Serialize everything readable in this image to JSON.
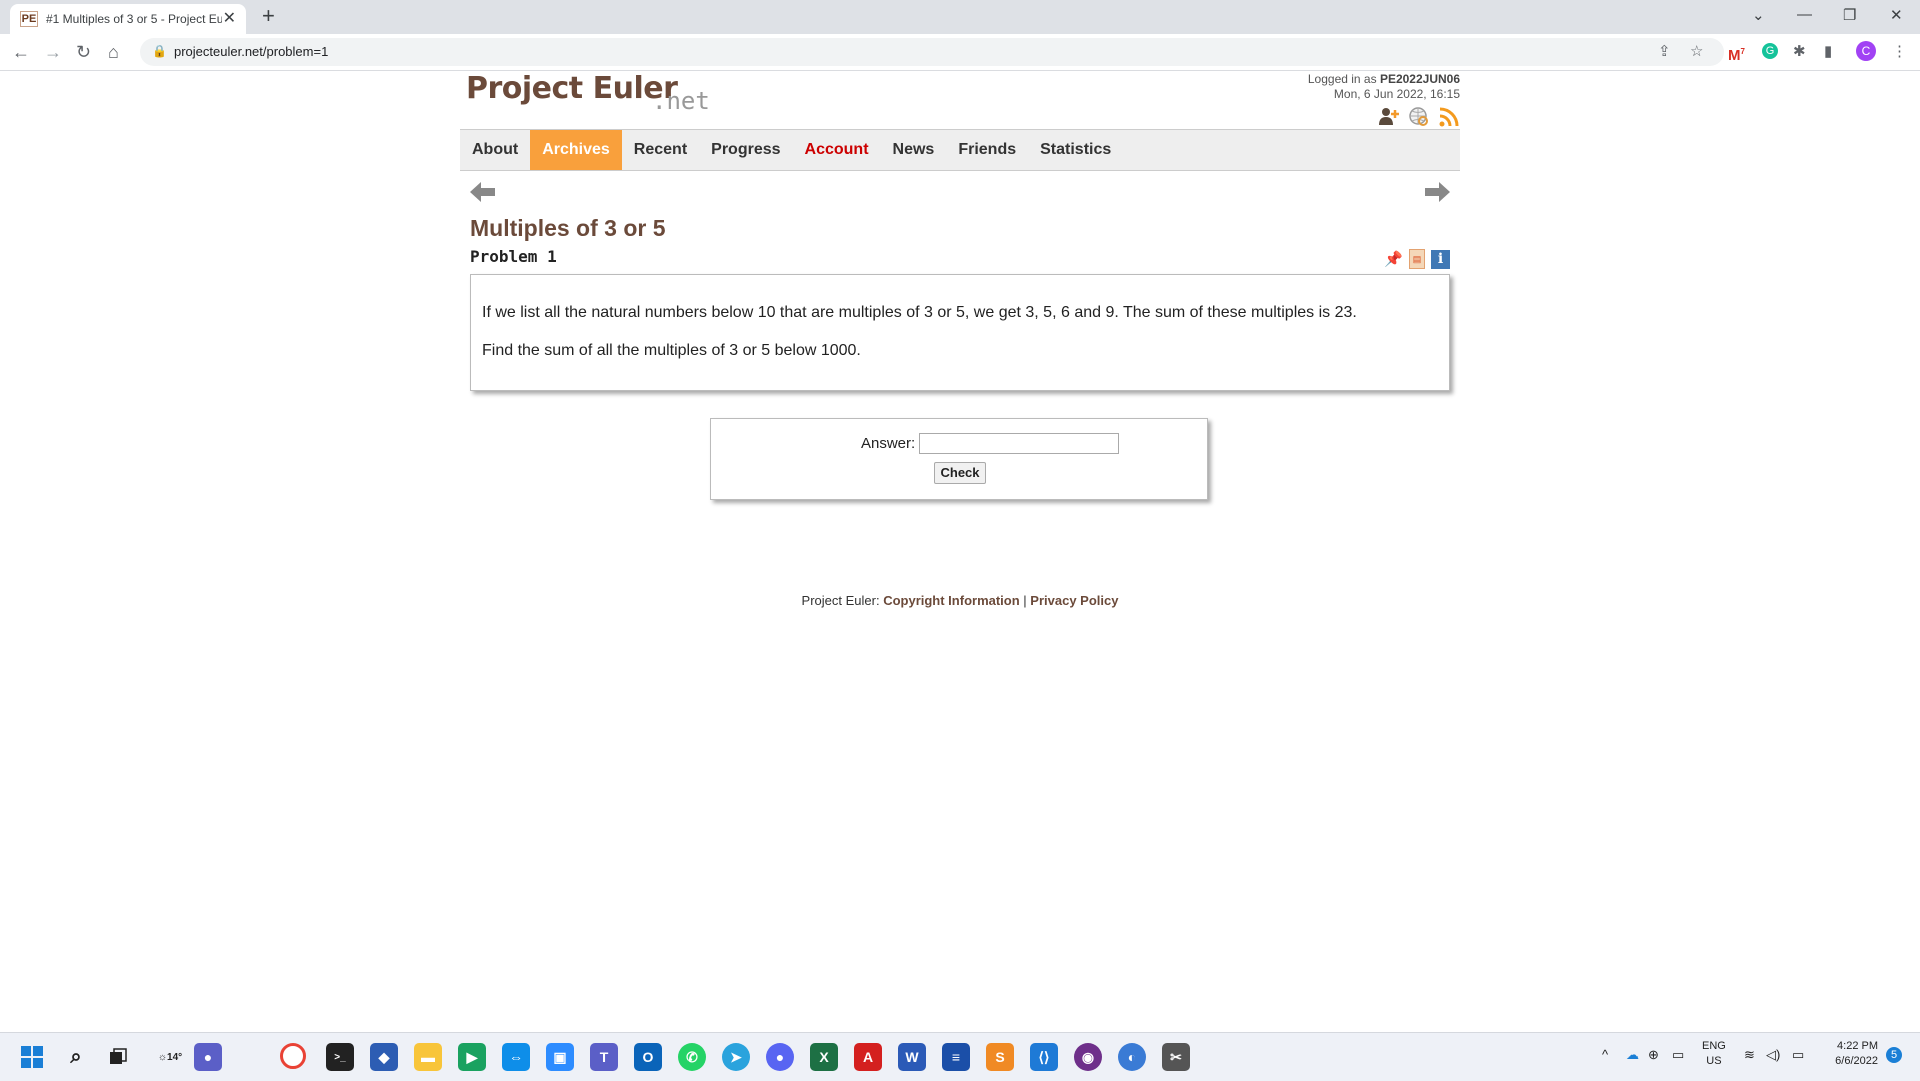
{
  "browser": {
    "favicon_text": "PE",
    "tab_title": "#1 Multiples of 3 or 5 - Project Euler",
    "url": "projecteuler.net/problem=1",
    "profile_initial": "C",
    "gmail_badge": "7"
  },
  "site": {
    "logo_main": "Project Euler",
    "logo_net": ".net",
    "logged_in_prefix": "Logged in as ",
    "username": "PE2022JUN06",
    "datetime": "Mon, 6 Jun 2022, 16:15"
  },
  "nav": {
    "items": [
      "About",
      "Archives",
      "Recent",
      "Progress",
      "Account",
      "News",
      "Friends",
      "Statistics"
    ],
    "active": "Archives",
    "accent": "#f9a03c"
  },
  "problem": {
    "title": "Multiples of 3 or 5",
    "number_label": "Problem 1",
    "paragraph1": "If we list all the natural numbers below 10 that are multiples of 3 or 5, we get 3, 5, 6 and 9. The sum of these multiples is 23.",
    "paragraph2": "Find the sum of all the multiples of 3 or 5 below 1000."
  },
  "answer": {
    "label": "Answer:",
    "value": "",
    "button": "Check"
  },
  "footer": {
    "prefix": "Project Euler: ",
    "copyright": "Copyright Information",
    "separator": " | ",
    "privacy": "Privacy Policy"
  },
  "taskbar": {
    "weather": "14°",
    "lang_top": "ENG",
    "lang_bottom": "US",
    "time": "4:22 PM",
    "date": "6/6/2022",
    "notifications": "5"
  }
}
